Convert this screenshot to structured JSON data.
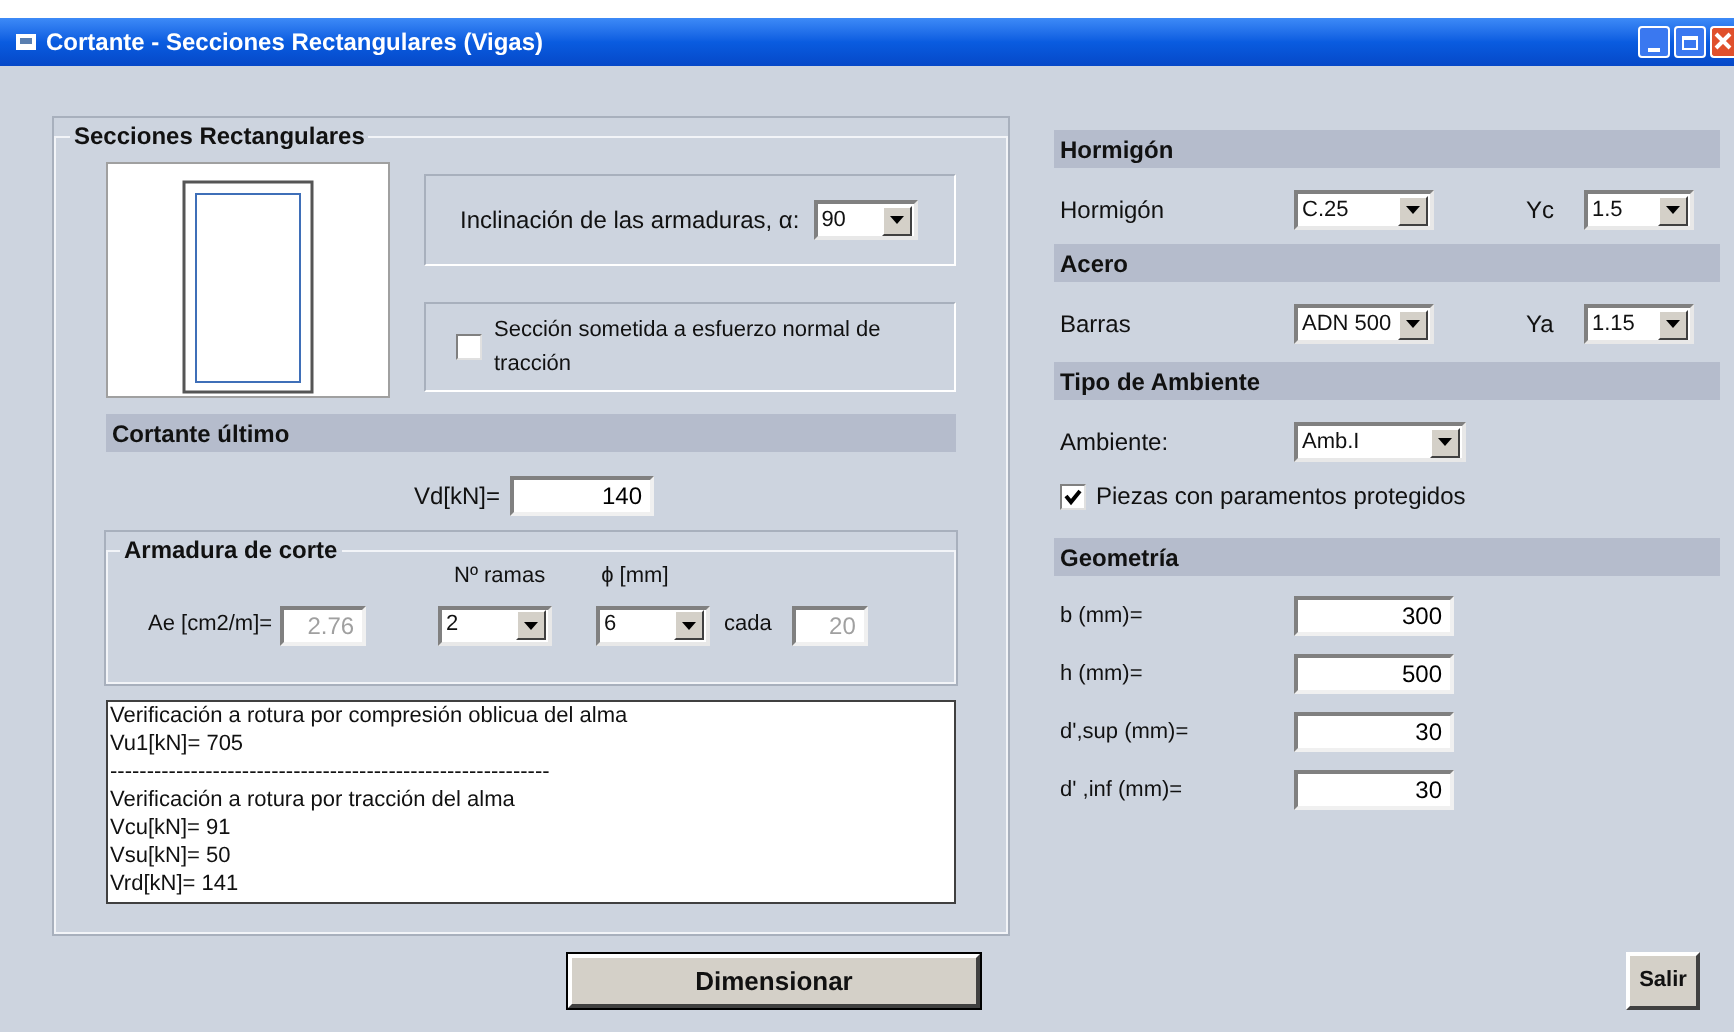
{
  "window": {
    "title": "Cortante - Secciones  Rectangulares (Vigas)"
  },
  "section": {
    "legend": "Secciones Rectangulares",
    "inclination": {
      "label": "Inclinación de las armaduras, α:",
      "value": "90"
    },
    "traction": {
      "label": "Sección sometida a esfuerzo normal de tracción",
      "checked": false
    },
    "cortante": {
      "header": "Cortante último",
      "vd_label": "Vd[kN]=",
      "vd_value": "140"
    },
    "armadura": {
      "legend": "Armadura de corte",
      "ramas_label": "Nº ramas",
      "phi_label": "ϕ [mm]",
      "ae_label": "Ae [cm2/m]=",
      "ae_value": "2.76",
      "ae_disabled": true,
      "ramas_value": "2",
      "phi_value": "6",
      "cada_label": "cada",
      "cada_value": "20",
      "cada_disabled": true
    },
    "results": [
      "Verificación a rotura por compresión oblicua del alma",
      "Vu1[kN]= 705",
      "------------------------------------------------------------",
      "Verificación a rotura por tracción del alma",
      "Vcu[kN]= 91",
      "Vsu[kN]= 50",
      "Vrd[kN]= 141"
    ]
  },
  "dimensionar": "Dimensionar",
  "hormigon": {
    "header": "Hormigón",
    "label": "Hormigón",
    "value": "C.25",
    "gamma_label": "Yc",
    "gamma_value": "1.5"
  },
  "acero": {
    "header": "Acero",
    "label": "Barras",
    "value": "ADN 500",
    "gamma_label": "Ya",
    "gamma_value": "1.15"
  },
  "ambiente": {
    "header": "Tipo de Ambiente",
    "label": "Ambiente:",
    "value": "Amb.I",
    "protegidos": {
      "label": "Piezas con paramentos protegidos",
      "checked": true
    }
  },
  "geometria": {
    "header": "Geometría",
    "fields": [
      {
        "label": "b (mm)=",
        "value": "300"
      },
      {
        "label": "h (mm)=",
        "value": "500"
      },
      {
        "label": "d',sup (mm)=",
        "value": "30"
      },
      {
        "label": "d' ,inf (mm)=",
        "value": "30"
      }
    ]
  },
  "salir": "Salir"
}
